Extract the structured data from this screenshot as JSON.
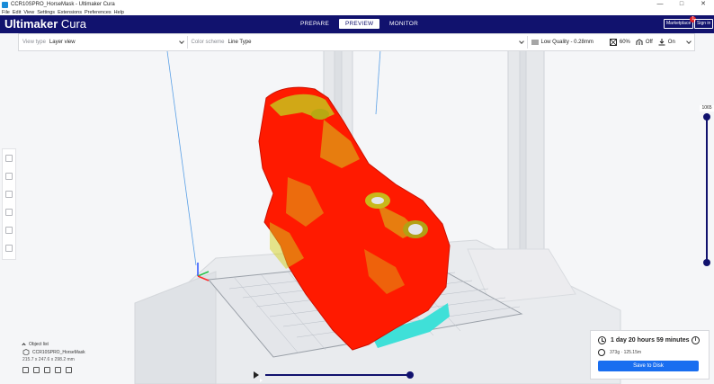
{
  "window": {
    "title": "CCR10SPRO_HorseMask - Ultimaker Cura",
    "minimize_glyph": "—",
    "maximize_glyph": "□",
    "close_glyph": "✕"
  },
  "menu": [
    "File",
    "Edit",
    "View",
    "Settings",
    "Extensions",
    "Preferences",
    "Help"
  ],
  "header": {
    "brand_bold": "Ultimaker",
    "brand_light": " Cura",
    "stages": [
      "PREPARE",
      "PREVIEW",
      "MONITOR"
    ],
    "active_stage": "PREVIEW",
    "marketplace_label": "Marketplace",
    "marketplace_badge": "1",
    "signin_label": "Sign in"
  },
  "toolbar": {
    "view_type_label": "View type",
    "view_type_value": "Layer view",
    "color_scheme_label": "Color scheme",
    "color_scheme_value": "Line Type",
    "quality": "Low Quality - 0.28mm",
    "infill": "60%",
    "support": "Off",
    "adhesion": "On"
  },
  "left_tools": [
    "move-icon",
    "scale-icon",
    "rotate-icon",
    "mirror-icon",
    "per-model-settings-icon",
    "support-blocker-icon"
  ],
  "layer_slider": {
    "value": "1065",
    "upper_fraction": 1.0,
    "lower_fraction": 0.0
  },
  "object_list": {
    "header": "Object list",
    "object_name": "CCR10SPRO_HorseMask",
    "dimensions": "215.7 x 247.6 x 298.2 mm"
  },
  "playback": {
    "progress": 1.0
  },
  "print_panel": {
    "time": "1 day 20 hours 59 minutes",
    "material": "373g · 125.15m",
    "info_glyph": "i",
    "save_label": "Save to Disk"
  },
  "colors": {
    "header_bg": "#11126e",
    "model_red": "#ff1a00",
    "model_yellow": "#c9c21a",
    "skirt_cyan": "#3fe0d8",
    "save_blue": "#196ef0"
  }
}
